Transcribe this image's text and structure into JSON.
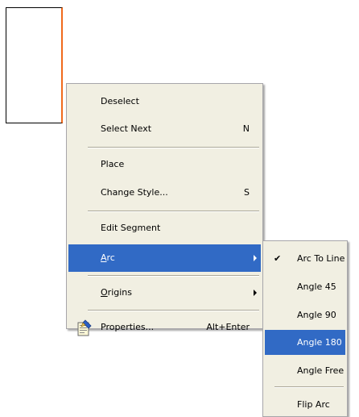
{
  "context_menu": {
    "items": [
      {
        "label": "Deselect"
      },
      {
        "label": "Select Next",
        "shortcut": "N"
      },
      {
        "label": "Place"
      },
      {
        "label": "Change Style...",
        "shortcut": "S"
      },
      {
        "label": "Edit Segment"
      },
      {
        "label_accel": "A",
        "label_rest": "rc",
        "highlighted": true,
        "has_submenu": true
      },
      {
        "label_accel": "O",
        "label_rest": "rigins",
        "has_submenu": true
      },
      {
        "label": "Properties...",
        "shortcut": "Alt+Enter",
        "icon": "properties-icon"
      }
    ]
  },
  "arc_submenu": {
    "check_mark": "✔",
    "items": [
      {
        "label": "Arc To Line",
        "checked": true
      },
      {
        "label": "Angle 45"
      },
      {
        "label": "Angle 90"
      },
      {
        "label": "Angle 180",
        "highlighted": true
      },
      {
        "label": "Angle Free"
      },
      {
        "label": "Flip Arc"
      }
    ]
  },
  "colors": {
    "menu_background": "#f1efe2",
    "highlight": "#316ac5",
    "segment_edge": "#f06a1c"
  }
}
